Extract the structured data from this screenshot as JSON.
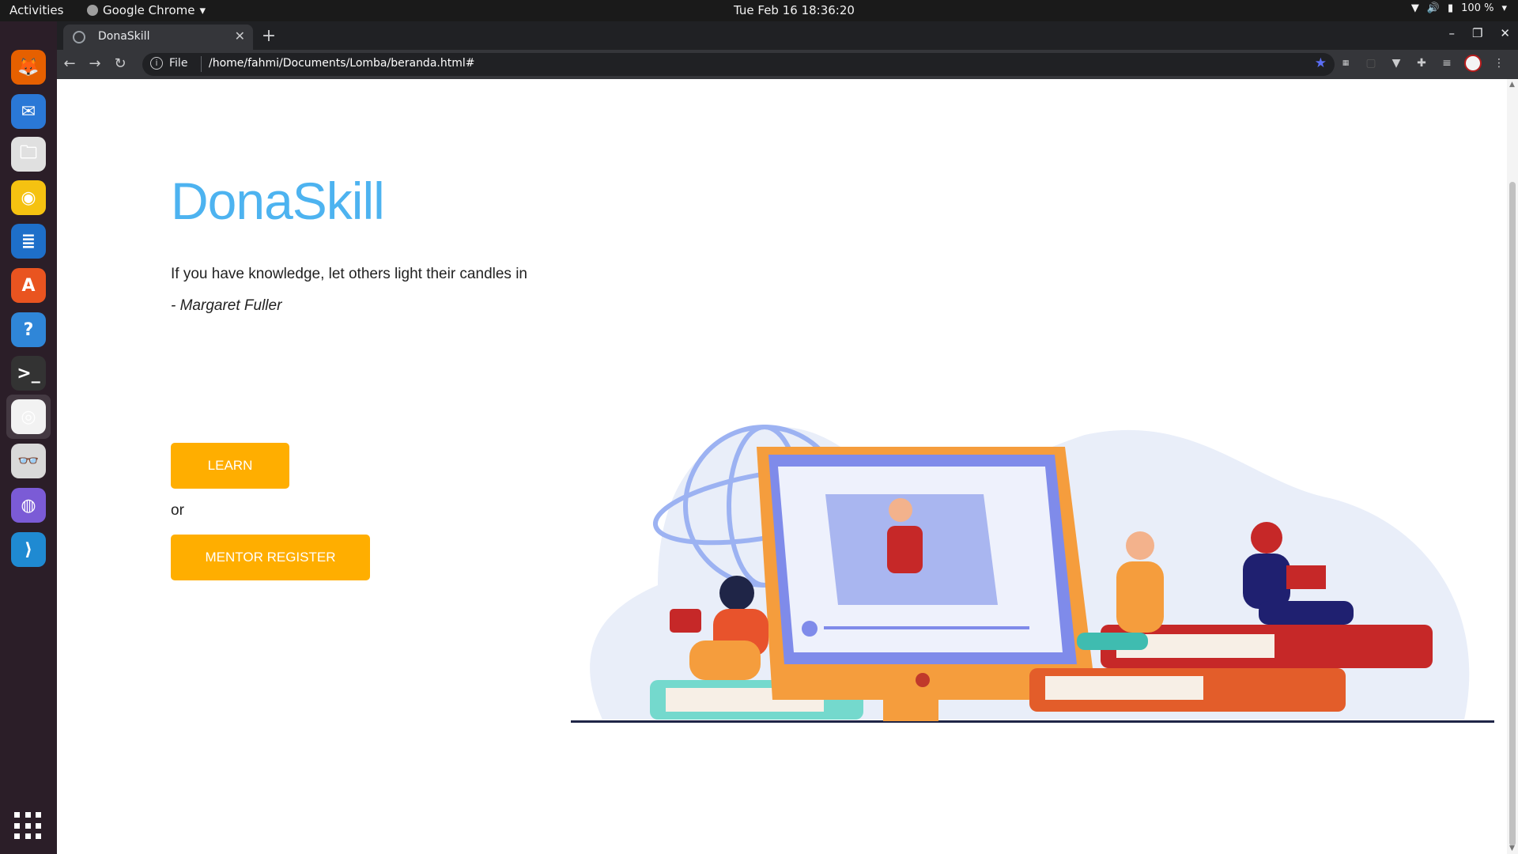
{
  "system": {
    "activities": "Activities",
    "app_menu": "Google Chrome",
    "clock": "Tue Feb 16  18:36:20",
    "battery": "100 %"
  },
  "dock": {
    "apps": [
      {
        "name": "firefox",
        "color": "#e66000",
        "glyph": "🦊"
      },
      {
        "name": "thunderbird",
        "color": "#2a78d6",
        "glyph": "✉"
      },
      {
        "name": "files",
        "color": "#e0e0e0",
        "glyph": "🗀"
      },
      {
        "name": "rhythmbox",
        "color": "#f5c211",
        "glyph": "◉"
      },
      {
        "name": "writer",
        "color": "#1e6fc9",
        "glyph": "≣"
      },
      {
        "name": "software",
        "color": "#e95420",
        "glyph": "A"
      },
      {
        "name": "help",
        "color": "#2f86d8",
        "glyph": "?"
      },
      {
        "name": "terminal",
        "color": "#333333",
        "glyph": ">_"
      },
      {
        "name": "chrome",
        "color": "#f2f2f2",
        "glyph": "◎"
      },
      {
        "name": "reader",
        "color": "#d9d9d9",
        "glyph": "👓"
      },
      {
        "name": "network",
        "color": "#7b5bd6",
        "glyph": "◍"
      },
      {
        "name": "vscode",
        "color": "#1f8ad2",
        "glyph": "⟩"
      }
    ]
  },
  "browser": {
    "tab_title": "DonaSkill",
    "url_scheme": "File",
    "url": "/home/fahmi/Documents/Lomba/beranda.html#"
  },
  "page": {
    "brand": "DonaSkill",
    "quote": "If you have knowledge, let others light their candles in",
    "author": "- Margaret Fuller",
    "learn_label": "LEARN",
    "or_label": "or",
    "mentor_label": "MENTOR REGISTER"
  },
  "colors": {
    "brand": "#4db3f0",
    "cta": "#ffae00"
  }
}
